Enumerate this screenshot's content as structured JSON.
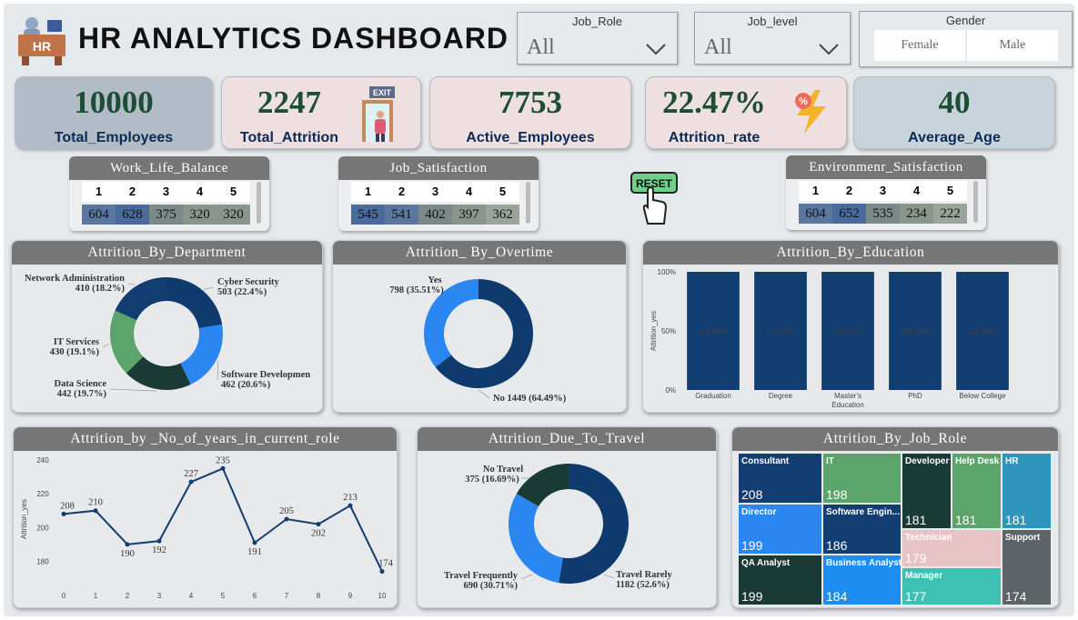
{
  "header": {
    "title": "HR ANALYTICS DASHBOARD",
    "logo_text": "HR"
  },
  "filters": {
    "job_role": {
      "label": "Job_Role",
      "value": "All"
    },
    "job_level": {
      "label": "Job_level",
      "value": "All"
    },
    "gender": {
      "label": "Gender",
      "options": [
        "Female",
        "Male"
      ]
    }
  },
  "kpis": [
    {
      "value": "10000",
      "label": "Total_Employees",
      "color": "#b1bcc7"
    },
    {
      "value": "2247",
      "label": "Total_Attrition",
      "color": "#eedfe0"
    },
    {
      "value": "7753",
      "label": "Active_Employees",
      "color": "#eedfe0"
    },
    {
      "value": "22.47%",
      "label": "Attrition_rate",
      "color": "#eedfe0"
    },
    {
      "value": "40",
      "label": "Average_Age",
      "color": "#c7d4dc"
    }
  ],
  "icons": {
    "exit_sign": "EXIT",
    "percent_sign": "%",
    "reset_label": "RESET"
  },
  "tables": [
    {
      "title": "Work_Life_Balance",
      "headers": [
        "1",
        "2",
        "3",
        "4",
        "5"
      ],
      "values": [
        "604",
        "628",
        "375",
        "320",
        "320"
      ]
    },
    {
      "title": "Job_Satisfaction",
      "headers": [
        "1",
        "2",
        "3",
        "4",
        "5"
      ],
      "values": [
        "545",
        "541",
        "402",
        "397",
        "362"
      ]
    },
    {
      "title": "Environmenr_Satisfaction",
      "headers": [
        "1",
        "2",
        "3",
        "4",
        "5"
      ],
      "values": [
        "604",
        "652",
        "535",
        "234",
        "222"
      ]
    }
  ],
  "chart_data": [
    {
      "id": "dept",
      "type": "pie",
      "title": "Attrition_By_Department",
      "slices": [
        {
          "label": "Cyber Security",
          "value": 503,
          "text": "503 (22.4%)",
          "color": "#0e3a6e"
        },
        {
          "label": "Software Development",
          "value": 462,
          "text": "462 (20.6%)",
          "color": "#2a86f0"
        },
        {
          "label": "Data Science",
          "value": 442,
          "text": "442 (19.7%)",
          "color": "#1a3b35"
        },
        {
          "label": "IT Services",
          "value": 430,
          "text": "430 (19.1%)",
          "color": "#5ba46b"
        },
        {
          "label": "Network Administration",
          "value": 410,
          "text": "410 (18.2%)",
          "color": "#123d70"
        }
      ],
      "label_display": [
        "Cyber Security",
        "Software Developmen",
        "Data Science",
        "IT Services",
        "Network Administration"
      ]
    },
    {
      "id": "overtime",
      "type": "pie",
      "title": "Attrition_ By_Overtime",
      "slices": [
        {
          "label": "No",
          "value": 1449,
          "text": "No 1449 (64.49%)",
          "color": "#0e3a6e"
        },
        {
          "label": "Yes",
          "value": 798,
          "text": "798 (35.51%)",
          "color": "#2a86f0"
        }
      ]
    },
    {
      "id": "education",
      "type": "bar",
      "title": "Attrition_By_Education",
      "categories": [
        "Graduation",
        "Degree",
        "Master's",
        "PhD",
        "Below College"
      ],
      "values": [
        100,
        100,
        100,
        100,
        100
      ],
      "value_labels": [
        "100.00%",
        "100.00%",
        "100.00%",
        "100.00%",
        "100.00%"
      ],
      "ylabel": "Attrition_yes",
      "xlabel": "Education",
      "yticks": [
        "100%",
        "50%",
        "0%"
      ],
      "ylim": [
        0,
        100
      ],
      "color": "#123d70"
    },
    {
      "id": "years_role",
      "type": "line",
      "title": "Attrition_by _No_of_years_in_current_role",
      "x": [
        0,
        1,
        2,
        3,
        4,
        5,
        6,
        7,
        8,
        9,
        10
      ],
      "y": [
        208,
        210,
        190,
        192,
        227,
        235,
        191,
        205,
        202,
        213,
        174
      ],
      "ylabel": "Attrition_yes",
      "yticks": [
        240,
        220,
        200,
        180
      ],
      "ylim": [
        170,
        240
      ],
      "color": "#123d70"
    },
    {
      "id": "travel",
      "type": "pie",
      "title": "Attrition_Due_To_Travel",
      "slices": [
        {
          "label": "Travel Rarely",
          "value": 1182,
          "text": "1182 (52.6%)",
          "color": "#0e3a6e"
        },
        {
          "label": "Travel Frequently",
          "value": 690,
          "text": "690 (30.71%)",
          "color": "#2a86f0"
        },
        {
          "label": "No Travel",
          "value": 375,
          "text": "375 (16.69%)",
          "color": "#1a3b35"
        }
      ]
    },
    {
      "id": "jobrole",
      "type": "treemap",
      "title": "Attrition_By_Job_Role",
      "items": [
        {
          "label": "Consultant",
          "value": 208,
          "color": "#133e72"
        },
        {
          "label": "IT",
          "value": 198,
          "color": "#5ba46b"
        },
        {
          "label": "Developer",
          "value": 181,
          "color": "#1a3b35"
        },
        {
          "label": "Help Desk",
          "value": 181,
          "color": "#5ba46b"
        },
        {
          "label": "HR",
          "value": 181,
          "color": "#2e95bd"
        },
        {
          "label": "Director",
          "value": 199,
          "color": "#2a86f0"
        },
        {
          "label": "Software Engin...",
          "value": 186,
          "color": "#133e72"
        },
        {
          "label": "Technician",
          "value": 179,
          "color": "#e7c3c6"
        },
        {
          "label": "Support",
          "value": 174,
          "color": "#5d6468"
        },
        {
          "label": "QA Analyst",
          "value": 199,
          "color": "#1a3b35"
        },
        {
          "label": "Business Analyst",
          "value": 184,
          "color": "#1d8ef0"
        },
        {
          "label": "Manager",
          "value": 177,
          "color": "#3ec1b3"
        }
      ]
    }
  ]
}
